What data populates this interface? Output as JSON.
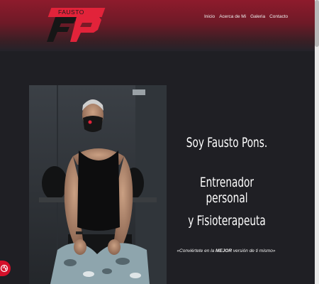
{
  "brand": {
    "name": "FAUSTO PONS"
  },
  "nav": {
    "items": [
      {
        "label": "Inicio"
      },
      {
        "label": "Acerca de Mi"
      },
      {
        "label": "Galeria"
      },
      {
        "label": "Contacto"
      }
    ]
  },
  "hero": {
    "title": "Soy Fausto Pons.",
    "line2": "Entrenador personal",
    "line3": "y Fisioterapeuta",
    "tagline_pre": "«Conviértete en la ",
    "tagline_bold": "MEJOR",
    "tagline_post": " versión de ti mismo»"
  },
  "colors": {
    "accent": "#e2233a",
    "header": "#8e1b2c",
    "background": "#1f1f24"
  },
  "icons": {
    "fab": "fitness-icon"
  }
}
